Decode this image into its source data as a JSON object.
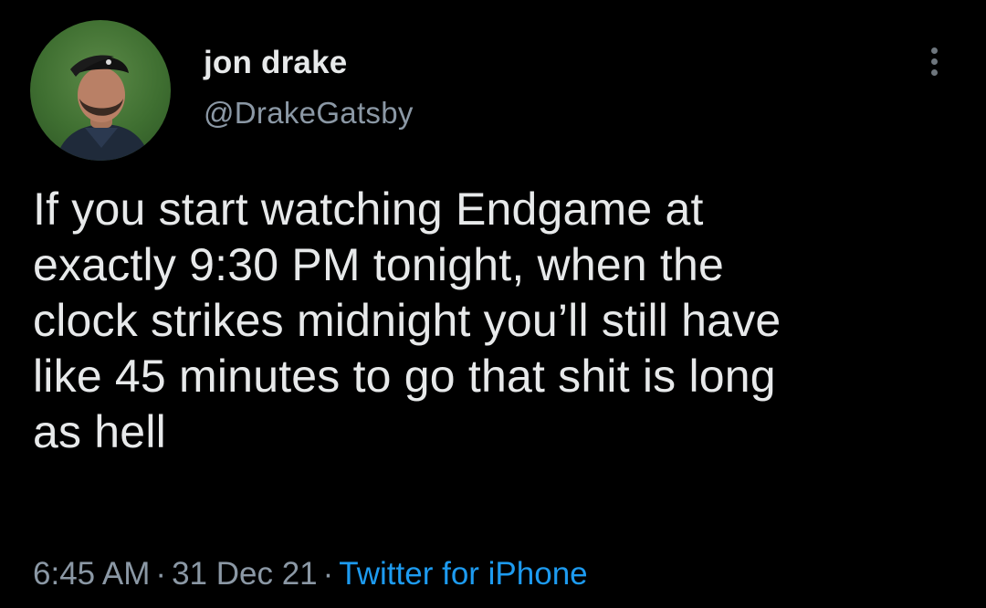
{
  "author": {
    "display_name": "jon drake",
    "handle": "@DrakeGatsby",
    "avatar_icon": "profile-photo"
  },
  "tweet": {
    "text_lines": [
      "If you start watching Endgame at",
      "exactly 9:30 PM tonight, when the",
      "clock strikes midnight you’ll still have",
      "like 45 minutes to go that shit is long",
      "as hell"
    ]
  },
  "meta": {
    "time": "6:45 AM",
    "separator": "·",
    "date": "31 Dec 21",
    "source": "Twitter for iPhone"
  },
  "menu": {
    "icon": "more-vertical-icon"
  },
  "colors": {
    "background": "#000000",
    "text": "#e7e9ea",
    "secondary_text": "#8b98a5",
    "link": "#1d9bf0"
  }
}
